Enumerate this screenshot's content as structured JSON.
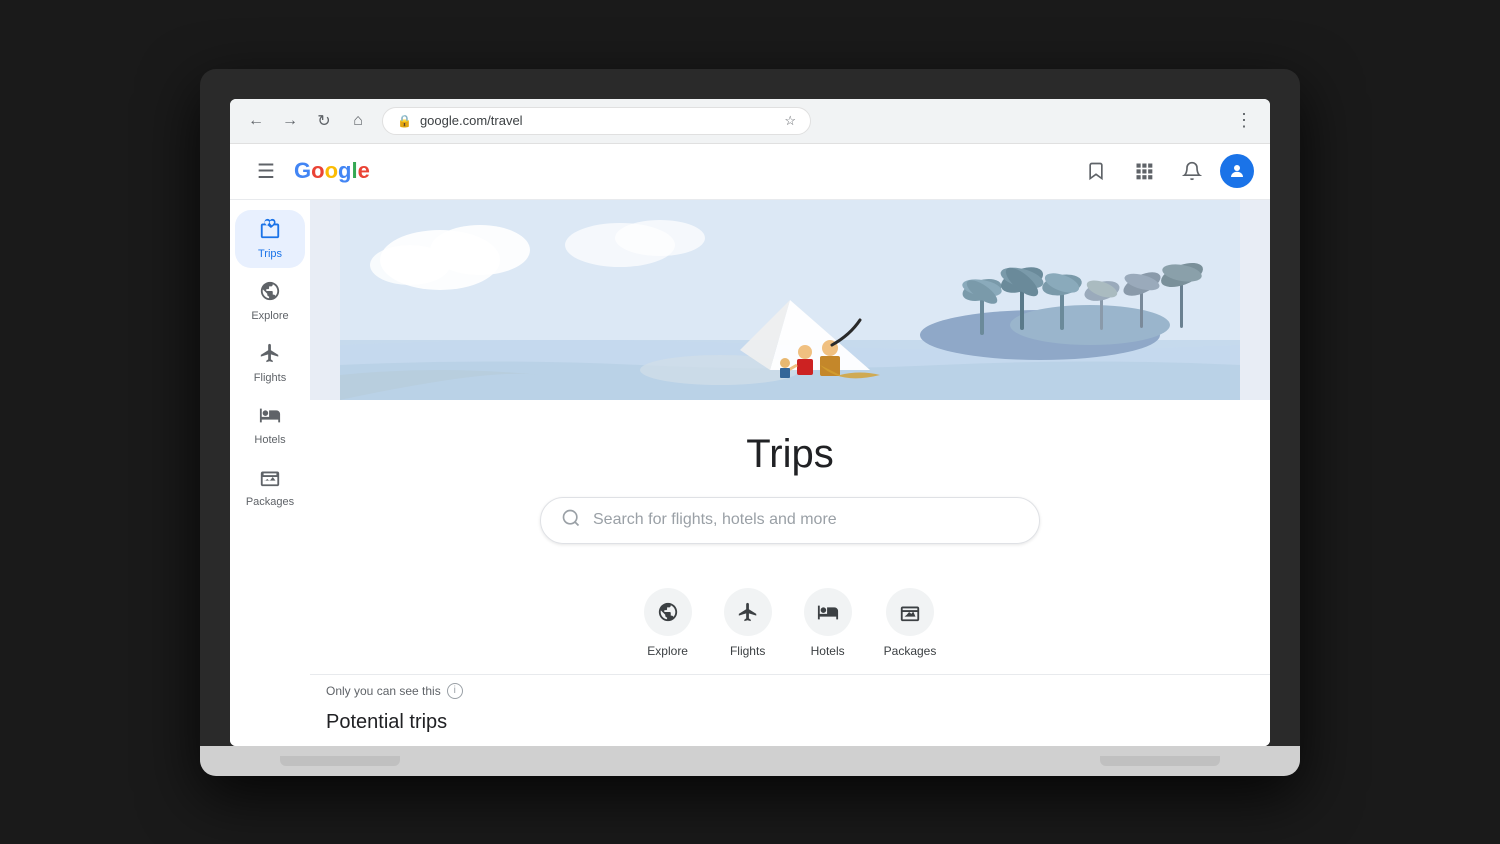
{
  "browser": {
    "url": "google.com/travel",
    "back_btn": "←",
    "forward_btn": "→",
    "refresh_btn": "↻",
    "home_btn": "⌂",
    "menu_btn": "⋮"
  },
  "header": {
    "hamburger": "☰",
    "google_logo": {
      "g": "G",
      "o1": "o",
      "o2": "o",
      "g2": "g",
      "l": "l",
      "e": "e"
    },
    "bookmark_icon": "🔖",
    "grid_icon": "⊞",
    "bell_icon": "🔔",
    "avatar_letter": "👤"
  },
  "sidebar": {
    "items": [
      {
        "id": "trips",
        "label": "Trips",
        "icon": "🧳",
        "active": true
      },
      {
        "id": "explore",
        "label": "Explore",
        "icon": "🧭",
        "active": false
      },
      {
        "id": "flights",
        "label": "Flights",
        "icon": "✈",
        "active": false
      },
      {
        "id": "hotels",
        "label": "Hotels",
        "icon": "🛏",
        "active": false
      },
      {
        "id": "packages",
        "label": "Packages",
        "icon": "🏖",
        "active": false
      }
    ]
  },
  "main": {
    "trips_title": "Trips",
    "search_placeholder": "Search for flights, hotels and more",
    "categories": [
      {
        "id": "explore",
        "label": "Explore",
        "icon": "🧭"
      },
      {
        "id": "flights",
        "label": "Flights",
        "icon": "✈"
      },
      {
        "id": "hotels",
        "label": "Hotels",
        "icon": "🛏"
      },
      {
        "id": "packages",
        "label": "Packages",
        "icon": "🏖"
      }
    ],
    "privacy_notice": "Only you can see this",
    "potential_trips_title": "Potential trips"
  }
}
